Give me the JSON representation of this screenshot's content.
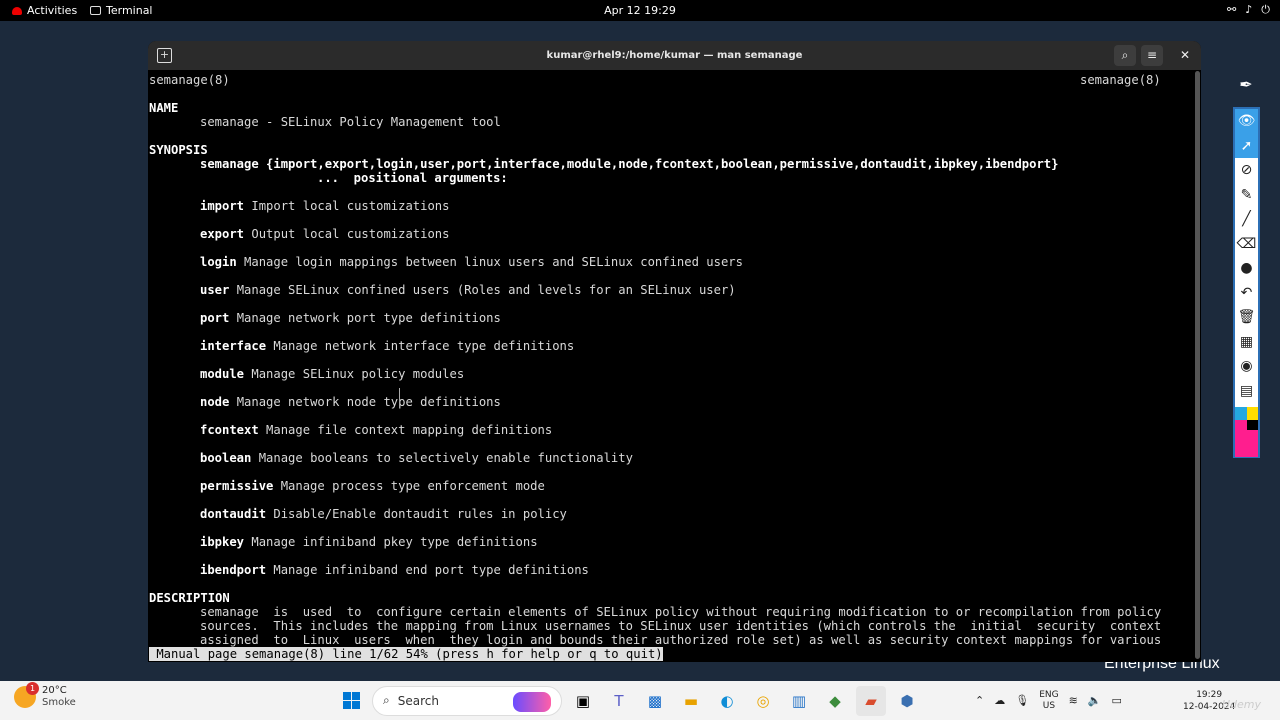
{
  "topbar": {
    "activities": "Activities",
    "app": "Terminal",
    "clock": "Apr 12  19:29",
    "tray_icons": [
      "network-icon",
      "volume-icon",
      "power-icon"
    ]
  },
  "window": {
    "title": "kumar@rhel9:/home/kumar — man semanage"
  },
  "man": {
    "header_left": "semanage(8)",
    "header_right": "semanage(8)",
    "name_heading": "NAME",
    "name_line": "semanage - SELinux Policy Management tool",
    "synopsis_heading": "SYNOPSIS",
    "synopsis_cmd": "semanage {import,export,login,user,port,interface,module,node,fcontext,boolean,permissive,dontaudit,ibpkey,ibendport}",
    "synopsis_args": "...  positional arguments:",
    "commands": [
      {
        "name": "import",
        "desc": " Import local customizations"
      },
      {
        "name": "export",
        "desc": " Output local customizations"
      },
      {
        "name": "login",
        "desc": " Manage login mappings between linux users and SELinux confined users"
      },
      {
        "name": "user",
        "desc": " Manage SELinux confined users (Roles and levels for an SELinux user)"
      },
      {
        "name": "port",
        "desc": " Manage network port type definitions"
      },
      {
        "name": "interface",
        "desc": " Manage network interface type definitions"
      },
      {
        "name": "module",
        "desc": " Manage SELinux policy modules"
      },
      {
        "name": "node",
        "desc": " Manage network node type definitions"
      },
      {
        "name": "fcontext",
        "desc": " Manage file context mapping definitions"
      },
      {
        "name": "boolean",
        "desc": " Manage booleans to selectively enable functionality"
      },
      {
        "name": "permissive",
        "desc": " Manage process type enforcement mode"
      },
      {
        "name": "dontaudit",
        "desc": " Disable/Enable dontaudit rules in policy"
      },
      {
        "name": "ibpkey",
        "desc": " Manage infiniband pkey type definitions"
      },
      {
        "name": "ibendport",
        "desc": " Manage infiniband end port type definitions"
      }
    ],
    "description_heading": "DESCRIPTION",
    "description_lines": [
      "semanage  is  used  to  configure certain elements of SELinux policy without requiring modification to or recompilation from policy",
      "sources.  This includes the mapping from Linux usernames to SELinux user identities (which controls the  initial  security  context",
      "assigned  to  Linux  users  when  they login and bounds their authorized role set) as well as security context mappings for various"
    ],
    "status_line": " Manual page semanage(8) line 1/62 54% (press h for help or q to quit)"
  },
  "desktop": {
    "brand": "Enterprise Linux"
  },
  "annotation_tools": [
    "pen-icon",
    "eye-icon",
    "pointer-icon",
    "no-pen-icon",
    "highlighter-icon",
    "line-icon",
    "eraser-icon",
    "dot-icon",
    "undo-icon",
    "trash-icon",
    "board-icon",
    "camera-icon",
    "clipboard-icon"
  ],
  "taskbar": {
    "weather_badge": "1",
    "temperature": "20°C",
    "condition": "Smoke",
    "search_label": "Search",
    "lang_line1": "ENG",
    "lang_line2": "US",
    "time": "19:29",
    "date": "12-04-2024"
  },
  "watermark": "Udemy"
}
